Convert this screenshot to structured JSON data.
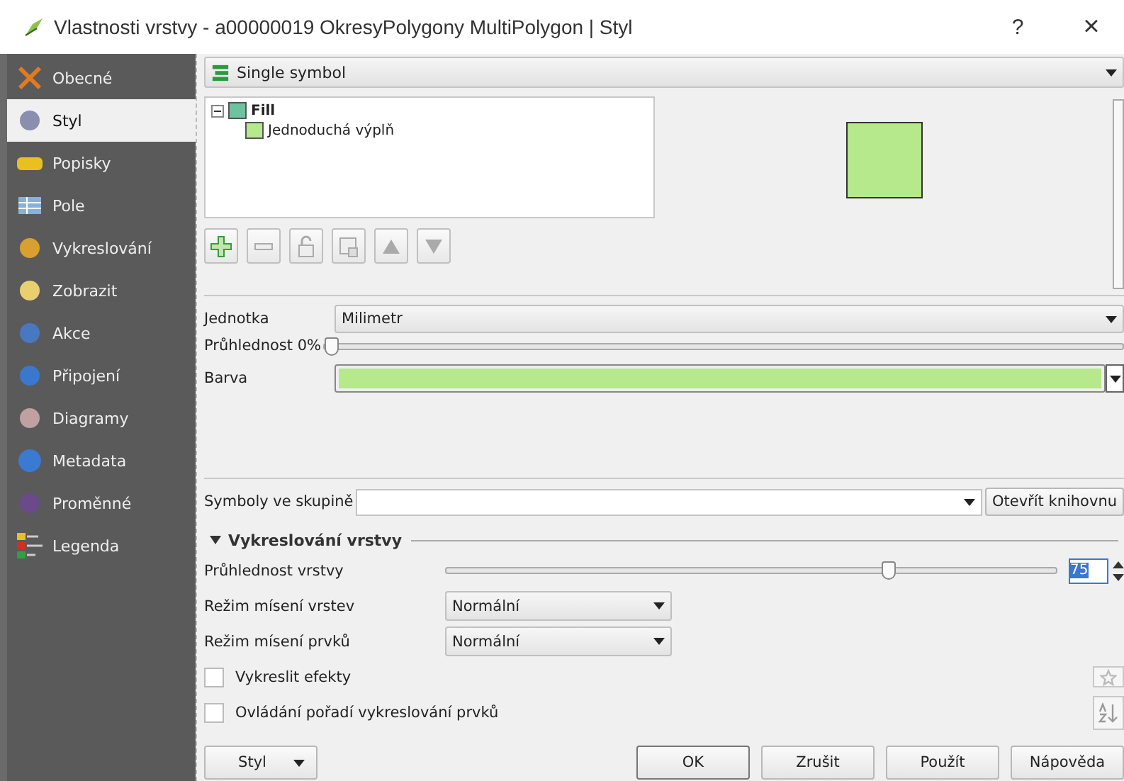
{
  "window": {
    "title": "Vlastnosti vrstvy - a00000019 OkresyPolygony MultiPolygon | Styl",
    "help": "?",
    "close": "×"
  },
  "sidebar": {
    "items": [
      {
        "label": "Obecné",
        "selected": false
      },
      {
        "label": "Styl",
        "selected": true
      },
      {
        "label": "Popisky",
        "selected": false
      },
      {
        "label": "Pole",
        "selected": false
      },
      {
        "label": "Vykreslování",
        "selected": false
      },
      {
        "label": "Zobrazit",
        "selected": false
      },
      {
        "label": "Akce",
        "selected": false
      },
      {
        "label": "Připojení",
        "selected": false
      },
      {
        "label": "Diagramy",
        "selected": false
      },
      {
        "label": "Metadata",
        "selected": false
      },
      {
        "label": "Proměnné",
        "selected": false
      },
      {
        "label": "Legenda",
        "selected": false
      }
    ]
  },
  "renderer": {
    "value": "Single symbol"
  },
  "symbol_tree": {
    "items": [
      {
        "label": "Fill",
        "color": "#6fc2a0",
        "expanded": true,
        "children": [
          {
            "label": "Jednoduchá výplň",
            "color": "#b5e98c"
          }
        ]
      }
    ]
  },
  "preview": {
    "color": "#b5e98c"
  },
  "layer_props": {
    "unit_label": "Jednotka",
    "unit_value": "Milimetr",
    "opacity": {
      "label": "Průhlednost 0%",
      "level": 0
    },
    "color_field": {
      "label": "Barva",
      "color": "#b5e98c"
    }
  },
  "symbols_group": {
    "label": "Symboly ve skupině",
    "open_library": "Otevřít knihovnu"
  },
  "rendering": {
    "title": "Vykreslování vrstvy",
    "expanded": true,
    "transparency_label": "Průhlednost vrstvy",
    "level": 0.73,
    "transparency_value": "75",
    "blend_rows": [
      {
        "label": "Režim mísení vrstev",
        "value": "Normální"
      },
      {
        "label": "Režim mísení prvků",
        "value": "Normální"
      }
    ],
    "checkboxes": [
      {
        "label": "Vykreslit efekty",
        "checked": false
      },
      {
        "label": "Ovládání pořadí vykreslování prvků",
        "checked": false
      }
    ]
  },
  "buttons": [
    {
      "label": "Styl",
      "kind": "menu"
    },
    {
      "label": "OK",
      "kind": "default"
    },
    {
      "label": "Zrušit",
      "kind": "plain"
    },
    {
      "label": "Použít",
      "kind": "plain"
    },
    {
      "label": "Nápověda",
      "kind": "plain"
    }
  ]
}
